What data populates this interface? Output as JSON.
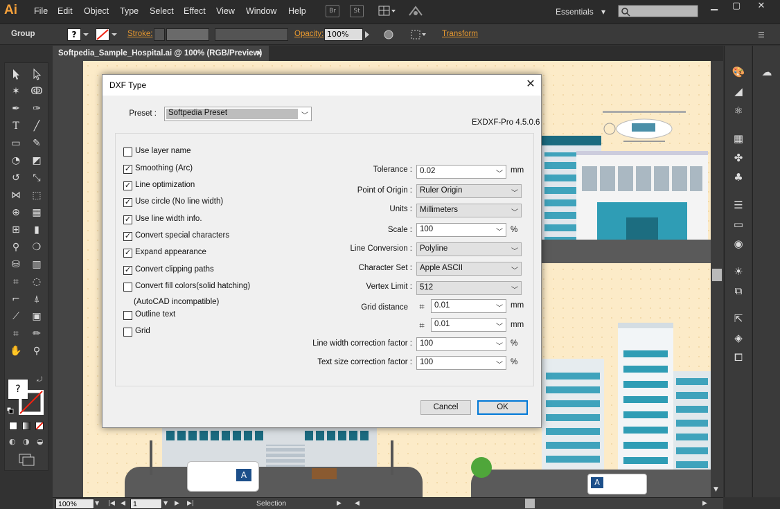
{
  "app": {
    "logo": "Ai"
  },
  "menu": [
    "File",
    "Edit",
    "Object",
    "Type",
    "Select",
    "Effect",
    "View",
    "Window",
    "Help"
  ],
  "toolbar_icons": {
    "bridge": "Br",
    "stock": "St"
  },
  "workspace": {
    "label": "Essentials",
    "arrow": "▾"
  },
  "control_bar": {
    "selection_type": "Group",
    "stroke_label": "Stroke:",
    "opacity_label": "Opacity:",
    "opacity_value": "100%",
    "transform_label": "Transform"
  },
  "document": {
    "tab_title": "Softpedia_Sample_Hospital.ai @ 100% (RGB/Preview)",
    "close_glyph": "×"
  },
  "status_bar": {
    "zoom": "100%",
    "artboard": "1",
    "tool": "Selection"
  },
  "dialog": {
    "title": "DXF Type",
    "close_glyph": "✕",
    "preset_label": "Preset :",
    "preset_value": "Softpedia Preset",
    "version": "EXDXF-Pro 4.5.0.6",
    "checkboxes": [
      {
        "label": "Use layer name",
        "checked": false
      },
      {
        "label": "Smoothing (Arc)",
        "checked": true
      },
      {
        "label": "Line optimization",
        "checked": true
      },
      {
        "label": "Use circle (No line width)",
        "checked": true
      },
      {
        "label": "Use line width info.",
        "checked": true
      },
      {
        "label": "Convert special characters",
        "checked": true
      },
      {
        "label": "Expand appearance",
        "checked": true
      },
      {
        "label": "Convert clipping paths",
        "checked": true
      },
      {
        "label": "Convert fill colors(solid hatching)",
        "checked": false
      },
      {
        "label": "Outline text",
        "checked": false
      },
      {
        "label": "Grid",
        "checked": false
      }
    ],
    "fill_note": "(AutoCAD incompatible)",
    "fields": {
      "tolerance": {
        "label": "Tolerance :",
        "value": "0.02",
        "unit": "mm"
      },
      "point_of_origin": {
        "label": "Point of Origin :",
        "value": "Ruler Origin"
      },
      "units": {
        "label": "Units :",
        "value": "Millimeters"
      },
      "scale": {
        "label": "Scale :",
        "value": "100",
        "unit": "%"
      },
      "line_conversion": {
        "label": "Line Conversion :",
        "value": "Polyline"
      },
      "character_set": {
        "label": "Character Set :",
        "value": "Apple ASCII"
      },
      "vertex_limit": {
        "label": "Vertex Limit :",
        "value": "512"
      },
      "grid_distance": {
        "label": "Grid distance",
        "x_value": "0.01",
        "y_value": "0.01",
        "unit": "mm"
      },
      "line_width_factor": {
        "label": "Line width correction factor :",
        "value": "100",
        "unit": "%"
      },
      "text_size_factor": {
        "label": "Text size correction factor :",
        "value": "100",
        "unit": "%"
      }
    },
    "buttons": {
      "cancel": "Cancel",
      "ok": "OK"
    }
  }
}
